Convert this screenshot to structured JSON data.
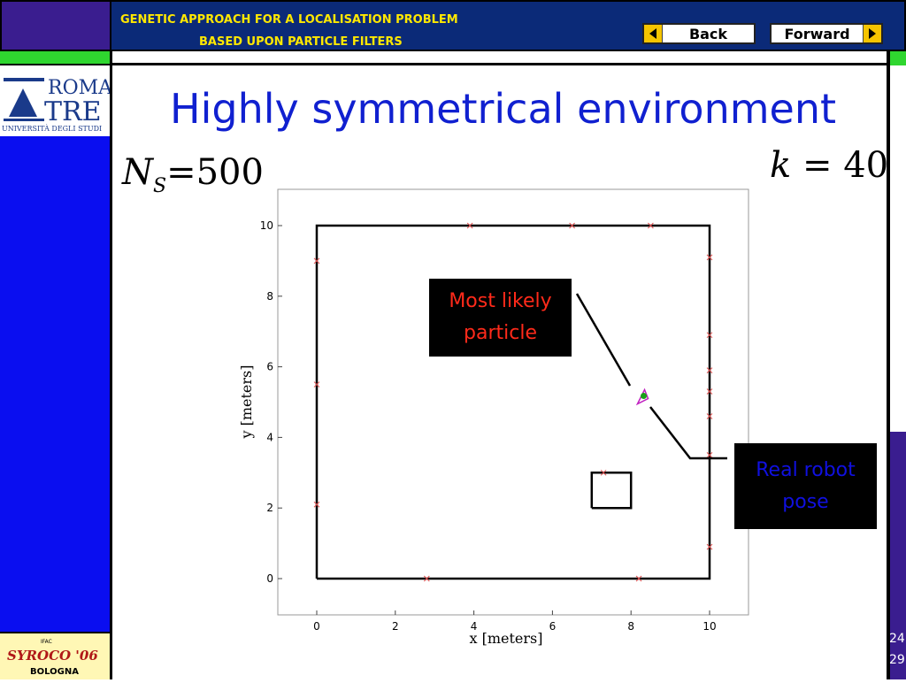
{
  "header": {
    "title_line1": "GENETIC APPROACH FOR A LOCALISATION PROBLEM",
    "title_line2": "BASED UPON PARTICLE FILTERS",
    "back_label": "Back",
    "forward_label": "Forward"
  },
  "logo": {
    "top": "ROMA",
    "bottom": "TRE",
    "subtitle": "UNIVERSITÀ DEGLI STUDI"
  },
  "conf_logo": {
    "tag": "IFAC",
    "name": "SYROCO '06",
    "city": "BOLOGNA"
  },
  "slide": {
    "title": "Highly symmetrical environment",
    "ns_var": "N",
    "ns_sub": "S",
    "ns_value": "=500",
    "k_var": "k",
    "k_value": "= 40"
  },
  "callouts": {
    "likely_line1": "Most likely",
    "likely_line2": "particle",
    "robot_line1": "Real robot",
    "robot_line2": "pose",
    "likely_color": "#ff2a1a",
    "robot_color": "#1010e0"
  },
  "page": {
    "current": "24",
    "total": "29"
  },
  "chart_data": {
    "type": "scatter",
    "xlabel": "x [meters]",
    "ylabel": "y [meters]",
    "xlim": [
      -1,
      11
    ],
    "ylim": [
      -1,
      11
    ],
    "x_ticks": [
      0,
      2,
      4,
      6,
      8,
      10
    ],
    "y_ticks": [
      0,
      2,
      4,
      6,
      8,
      10
    ],
    "walls": [
      {
        "x": [
          0,
          10,
          10,
          0,
          0
        ],
        "y": [
          0,
          0,
          10,
          10,
          0
        ]
      },
      {
        "x": [
          7,
          8,
          8,
          7,
          7
        ],
        "y": [
          2,
          2,
          3,
          3,
          2
        ]
      }
    ],
    "landmarks": [
      {
        "x": 3.9,
        "y": 10
      },
      {
        "x": 6.5,
        "y": 10
      },
      {
        "x": 8.5,
        "y": 10
      },
      {
        "x": 0,
        "y": 9
      },
      {
        "x": 0,
        "y": 5.5
      },
      {
        "x": 0,
        "y": 2.1
      },
      {
        "x": 10,
        "y": 9.1
      },
      {
        "x": 10,
        "y": 6.9
      },
      {
        "x": 10,
        "y": 5.9
      },
      {
        "x": 10,
        "y": 5.3
      },
      {
        "x": 10,
        "y": 4.6
      },
      {
        "x": 10,
        "y": 3.5
      },
      {
        "x": 10,
        "y": 0.9
      },
      {
        "x": 2.8,
        "y": 0
      },
      {
        "x": 8.2,
        "y": 0
      },
      {
        "x": 7.3,
        "y": 3
      }
    ],
    "robot_pose": {
      "x": 8.3,
      "y": 5.15
    },
    "landmark_color": "#e05050",
    "wall_color": "#000000"
  }
}
